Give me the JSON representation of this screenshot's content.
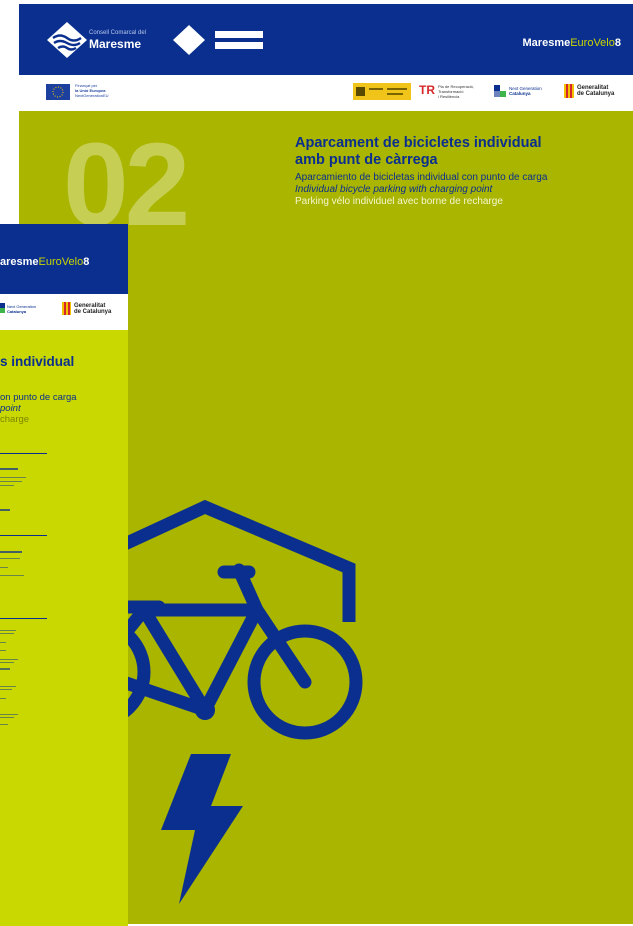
{
  "council": {
    "line1": "Consell Comarcal del",
    "line2": "Maresme"
  },
  "brand": {
    "part1": "Maresme",
    "part2": "EuroVelo",
    "part3": "8"
  },
  "funding": {
    "eu_line1": "Finançat per",
    "eu_line2": "la Unió Europea",
    "eu_line3": "NextGenerationEU",
    "plan_line1": "Pla de Recuperació,",
    "plan_line2": "Transformació",
    "plan_line3": "i Resiliència",
    "ng_line1": "Next Generation",
    "ng_line2": "Catalunya",
    "gencat_line1": "Generalitat",
    "gencat_line2": "de Catalunya"
  },
  "sheet": {
    "number": "02",
    "title_line1": "Aparcament de bicicletes individual",
    "title_line2": "amb punt de càrrega",
    "es": "Aparcamiento de bicicletas individual con punto de carga",
    "en": "Individual bicycle parking with charging point",
    "fr": "Parking vélo individuel avec borne de recharge"
  },
  "front": {
    "brand_visible": "aresme",
    "title_fragment": "s individual",
    "es_fragment": "on punto de carga",
    "en_fragment": "point",
    "fr_fragment": "charge"
  },
  "colors": {
    "navy": "#0a2f8f",
    "olive": "#aab500",
    "lime": "#c8d800"
  },
  "icons": [
    "wave-logo-icon",
    "diamond-bars-icon",
    "eu-flag-icon",
    "bicycle-shelter-icon",
    "lightning-bolt-icon"
  ]
}
